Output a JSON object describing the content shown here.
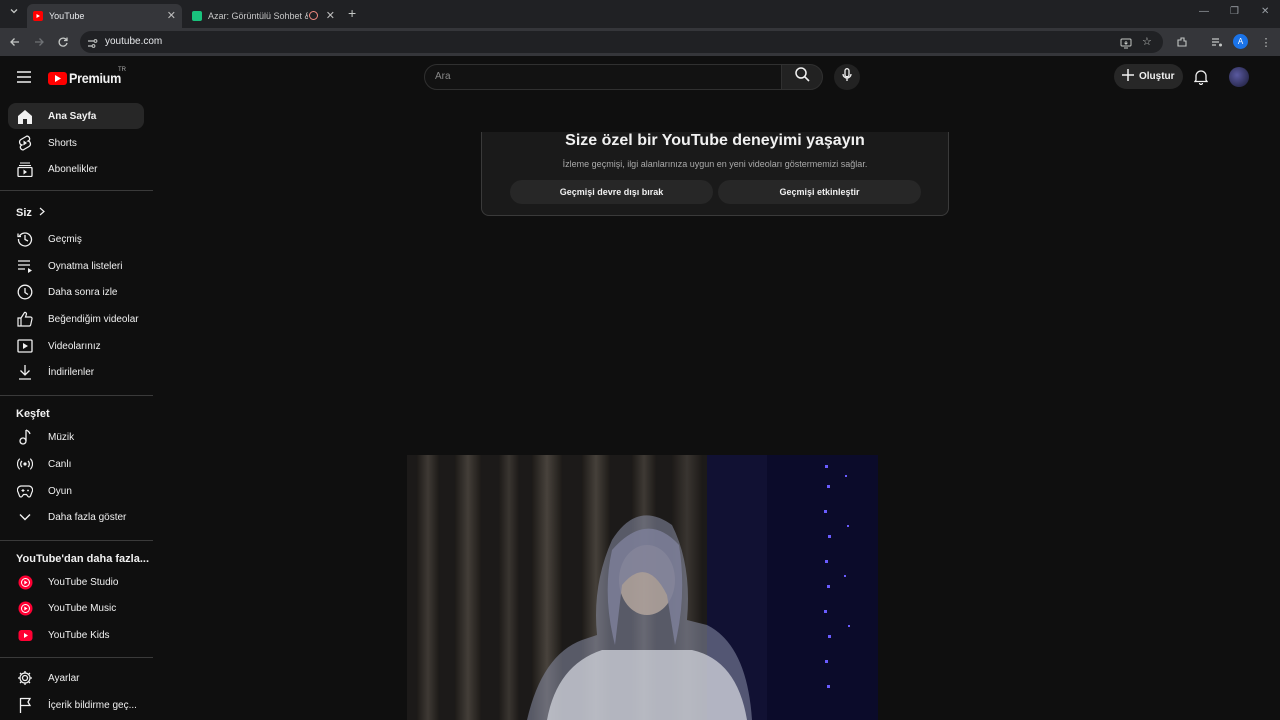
{
  "browser": {
    "tabs": [
      {
        "title": "YouTube",
        "active": true
      },
      {
        "title": "Azar: Görüntülü Sohbet & V",
        "active": false
      }
    ],
    "url": "youtube.com",
    "profile_initial": "A"
  },
  "header": {
    "logo_text": "Premium",
    "region": "TR",
    "search_placeholder": "Ara",
    "create_label": "Oluştur"
  },
  "sidebar": {
    "main": [
      {
        "label": "Ana Sayfa",
        "icon": "home-icon"
      },
      {
        "label": "Shorts",
        "icon": "shorts-icon"
      },
      {
        "label": "Abonelikler",
        "icon": "subscriptions-icon"
      }
    ],
    "you_heading": "Siz",
    "you": [
      {
        "label": "Geçmiş",
        "icon": "history-icon"
      },
      {
        "label": "Oynatma listeleri",
        "icon": "playlists-icon"
      },
      {
        "label": "Daha sonra izle",
        "icon": "clock-icon"
      },
      {
        "label": "Beğendiğim videolar",
        "icon": "thumbs-up-icon"
      },
      {
        "label": "Videolarınız",
        "icon": "your-videos-icon"
      },
      {
        "label": "İndirilenler",
        "icon": "download-icon"
      }
    ],
    "explore_heading": "Keşfet",
    "explore": [
      {
        "label": "Müzik",
        "icon": "music-icon"
      },
      {
        "label": "Canlı",
        "icon": "live-icon"
      },
      {
        "label": "Oyun",
        "icon": "gaming-icon"
      },
      {
        "label": "Daha fazla göster",
        "icon": "chevron-down-icon"
      }
    ],
    "more_heading": "YouTube'dan daha fazla...",
    "more": [
      {
        "label": "YouTube Studio",
        "icon": "youtube-studio-icon"
      },
      {
        "label": "YouTube Music",
        "icon": "youtube-music-icon"
      },
      {
        "label": "YouTube Kids",
        "icon": "youtube-kids-icon"
      }
    ],
    "bottom": [
      {
        "label": "Ayarlar",
        "icon": "settings-icon"
      },
      {
        "label": "İçerik bildirme geç...",
        "icon": "flag-icon"
      }
    ]
  },
  "history_prompt": {
    "title": "Size özel bir YouTube deneyimi yaşayın",
    "description": "İzleme geçmişi, ilgi alanlarınıza uygun en yeni videoları göstermemizi sağlar.",
    "disable_button": "Geçmişi devre dışı bırak",
    "enable_button": "Geçmişi etkinleştir"
  },
  "colors": {
    "brand_red": "#ff0000",
    "background": "#0f0f0f",
    "active_item": "#272727"
  }
}
